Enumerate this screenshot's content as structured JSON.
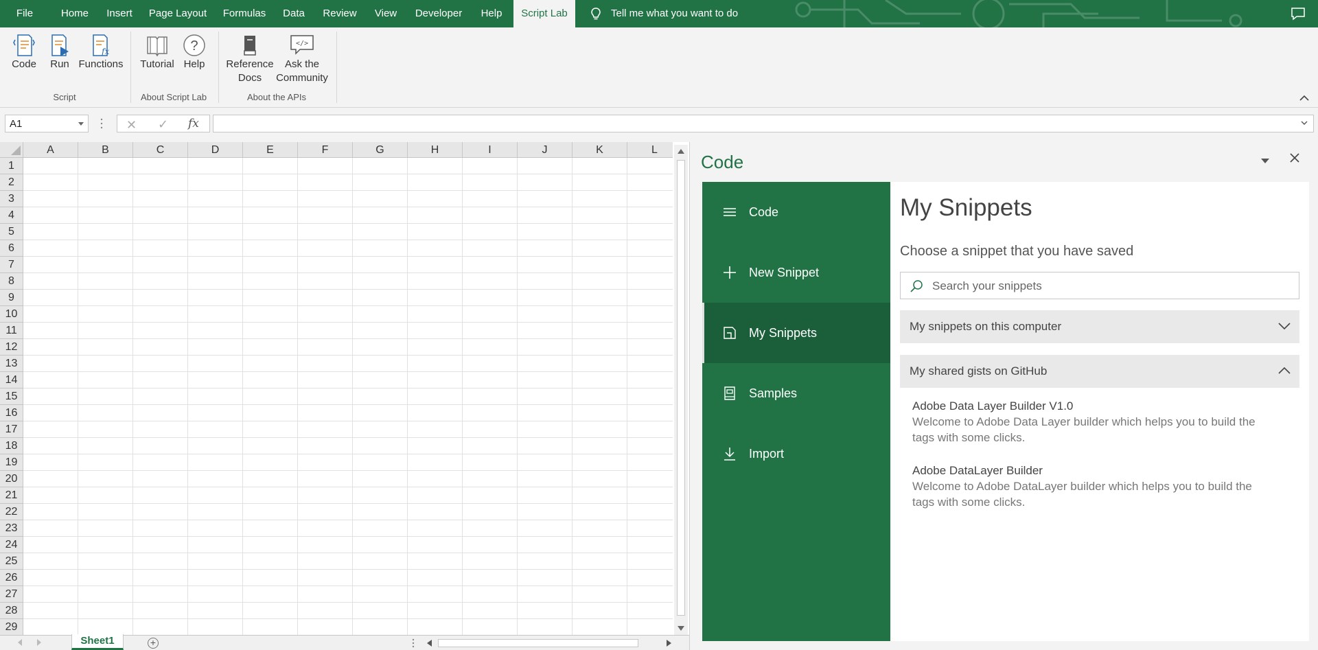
{
  "tabs": [
    {
      "label": "File",
      "active": false
    },
    {
      "label": "Home",
      "active": false
    },
    {
      "label": "Insert",
      "active": false
    },
    {
      "label": "Page Layout",
      "active": false
    },
    {
      "label": "Formulas",
      "active": false
    },
    {
      "label": "Data",
      "active": false
    },
    {
      "label": "Review",
      "active": false
    },
    {
      "label": "View",
      "active": false
    },
    {
      "label": "Developer",
      "active": false
    },
    {
      "label": "Help",
      "active": false
    },
    {
      "label": "Script Lab",
      "active": true
    }
  ],
  "tell_me": "Tell me what you want to do",
  "ribbon": {
    "code": "Code",
    "run": "Run",
    "functions": "Functions",
    "group_script": "Script",
    "tutorial": "Tutorial",
    "help": "Help",
    "group_about_script_lab": "About Script Lab",
    "reference_docs_1": "Reference",
    "reference_docs_2": "Docs",
    "ask_community_1": "Ask the",
    "ask_community_2": "Community",
    "group_about_apis": "About the APIs"
  },
  "formula_bar": {
    "name_box": "A1",
    "formula": ""
  },
  "grid": {
    "columns": [
      "A",
      "B",
      "C",
      "D",
      "E",
      "F",
      "G",
      "H",
      "I",
      "J",
      "K",
      "L"
    ],
    "rows": [
      "1",
      "2",
      "3",
      "4",
      "5",
      "6",
      "7",
      "8",
      "9",
      "10",
      "11",
      "12",
      "13",
      "14",
      "15",
      "16",
      "17",
      "18",
      "19",
      "20",
      "21",
      "22",
      "23",
      "24",
      "25",
      "26",
      "27",
      "28",
      "29"
    ]
  },
  "sheet_tab": "Sheet1",
  "pane": {
    "title": "Code",
    "nav": [
      {
        "label": "Code",
        "icon": "hamburger-icon",
        "active": false
      },
      {
        "label": "New Snippet",
        "icon": "plus-icon",
        "active": false
      },
      {
        "label": "My Snippets",
        "icon": "snippets-icon",
        "active": true
      },
      {
        "label": "Samples",
        "icon": "book-icon",
        "active": false
      },
      {
        "label": "Import",
        "icon": "download-icon",
        "active": false
      }
    ],
    "content": {
      "title": "My Snippets",
      "subtitle": "Choose a snippet that you have saved",
      "search_placeholder": "Search your snippets",
      "accordion_local": "My snippets on this computer",
      "accordion_github": "My shared gists on GitHub",
      "gists": [
        {
          "title": "Adobe Data Layer Builder V1.0",
          "desc_1": "Welcome to Adobe Data Layer builder which helps you to build the",
          "desc_2": "tags with some clicks."
        },
        {
          "title": "Adobe DataLayer Builder",
          "desc_1": "Welcome to Adobe DataLayer builder which helps you to build the",
          "desc_2": "tags with some clicks."
        }
      ]
    }
  },
  "colors": {
    "excel_green": "#217346",
    "nav_active": "#1b5e3a"
  }
}
